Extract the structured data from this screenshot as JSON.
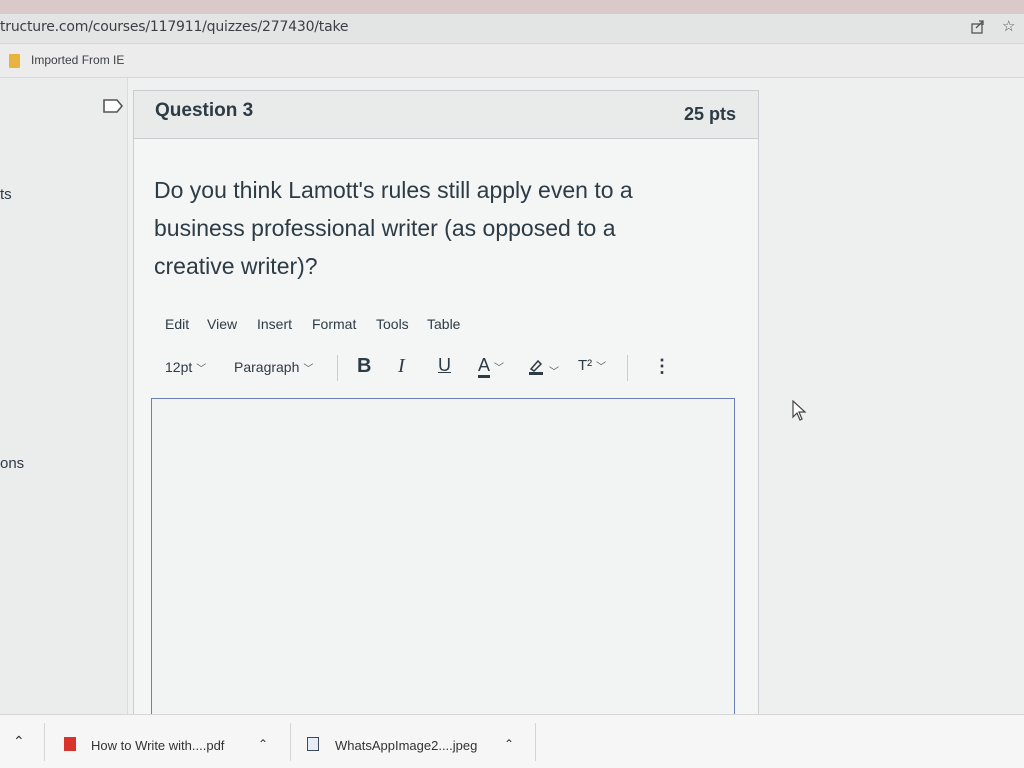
{
  "browser": {
    "url": "tructure.com/courses/117911/quizzes/277430/take",
    "share_icon": "share-icon",
    "star_icon": "star-icon",
    "bookmark_label": "Imported From IE"
  },
  "sidebar": {
    "fragment_1": "ts",
    "fragment_2": "ons"
  },
  "question": {
    "title": "Question 3",
    "points": "25 pts",
    "text_line_1": "Do you think Lamott's rules still apply even to a",
    "text_line_2": "business professional writer (as opposed to a",
    "text_line_3": "creative writer)?"
  },
  "editor": {
    "menu": [
      "Edit",
      "View",
      "Insert",
      "Format",
      "Tools",
      "Table"
    ],
    "font_size": "12pt",
    "block_format": "Paragraph",
    "bold": "B",
    "italic": "I",
    "underline": "U",
    "text_color": "A",
    "superscript": "T²",
    "more": "⋮",
    "content": ""
  },
  "downloads": [
    {
      "name": "How to Write with....pdf",
      "icon": "pdf-icon"
    },
    {
      "name": "WhatsAppImage2....jpeg",
      "icon": "image-file-icon"
    }
  ],
  "colors": {
    "text": "#2d3b45",
    "editor_border": "#6b7fb5",
    "pdf_red": "#d9342b"
  }
}
